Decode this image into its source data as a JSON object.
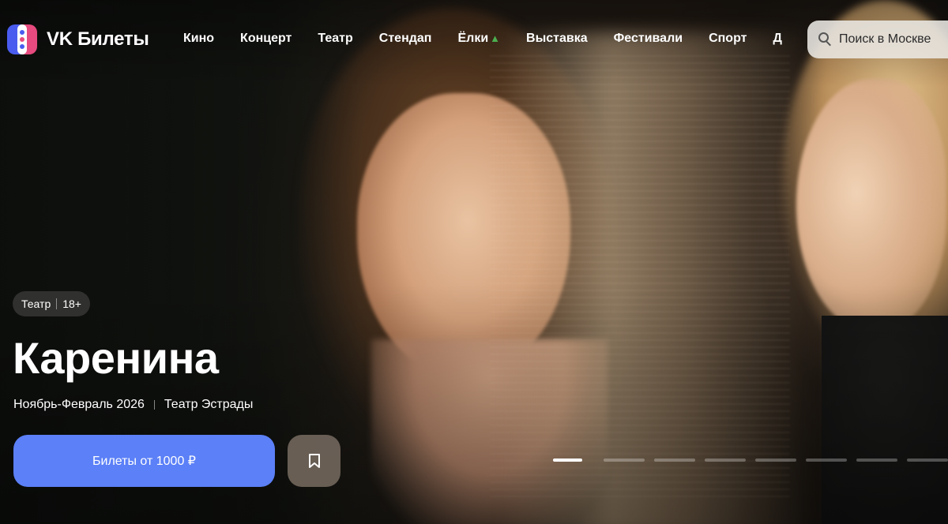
{
  "header": {
    "logo_text": "VK Билеты",
    "nav": [
      {
        "label": "Кино"
      },
      {
        "label": "Концерт"
      },
      {
        "label": "Театр"
      },
      {
        "label": "Стендап"
      },
      {
        "label": "Ёлки",
        "icon": "christmas-tree-icon"
      },
      {
        "label": "Выставка"
      },
      {
        "label": "Фестивали"
      },
      {
        "label": "Спорт"
      },
      {
        "label": "Д"
      }
    ],
    "search": {
      "placeholder": "Поиск в Москве",
      "icon": "search-icon"
    }
  },
  "hero": {
    "badge": {
      "category": "Театр",
      "age": "18+"
    },
    "title": "Каренина",
    "dates": "Ноябрь-Февраль 2026",
    "venue": "Театр Эстрады",
    "tickets_button": "Билеты от 1000 ₽",
    "bookmark_icon": "bookmark-icon",
    "slides_total": 8,
    "slide_active": 1
  },
  "colors": {
    "accent_button": "#5b80f7",
    "logo_blue": "#4a5cf0",
    "logo_pink": "#e64a7e"
  }
}
